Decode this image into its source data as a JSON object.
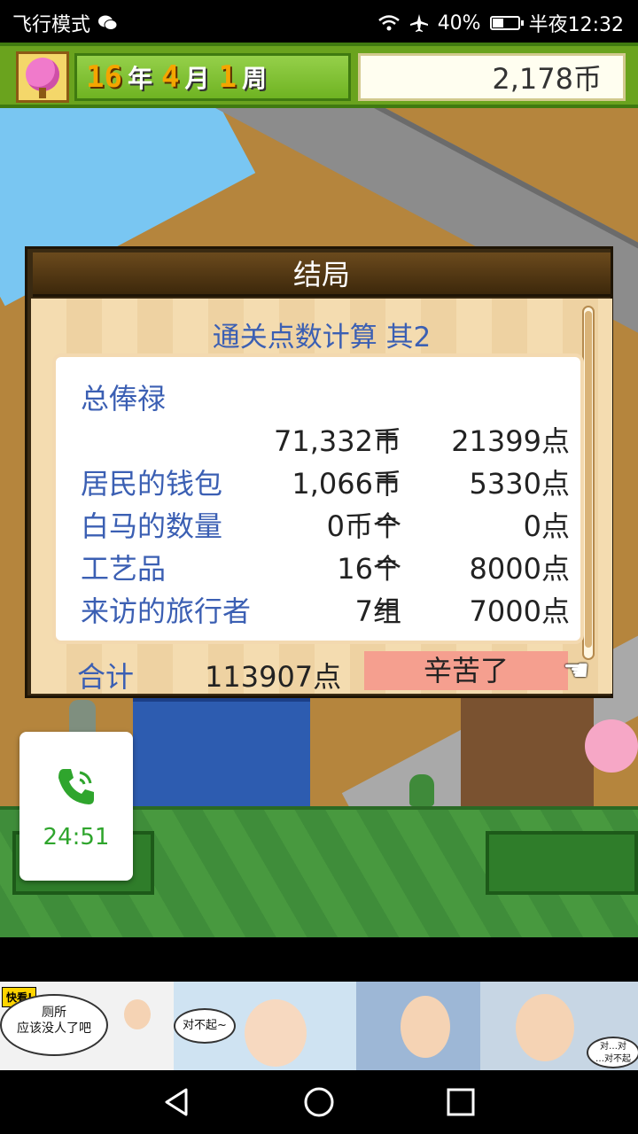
{
  "status_bar": {
    "airplane_mode_text": "飞行模式",
    "battery_percent": "40%",
    "battery_level": 0.4,
    "time": "半夜12:32"
  },
  "game_header": {
    "year_num": "16",
    "year_unit": "年",
    "month_num": "4",
    "month_unit": "月",
    "week_num": "1",
    "week_unit": "周",
    "coins": "2,178币"
  },
  "dialog": {
    "title": "结局",
    "subtitle": "通关点数计算 其2",
    "rows": [
      {
        "label": "总俸禄",
        "value": "",
        "eq": "",
        "points": ""
      },
      {
        "label": "",
        "value": "71,332币",
        "eq": "=",
        "points": "21399点"
      },
      {
        "label": "居民的钱包",
        "value": "1,066币",
        "eq": "=",
        "points": "5330点"
      },
      {
        "label": "白马的数量",
        "value": "0币个",
        "eq": "=",
        "points": "0点"
      },
      {
        "label": "工艺品",
        "value": "16个",
        "eq": "=",
        "points": "8000点"
      },
      {
        "label": "来访的旅行者",
        "value": "7组",
        "eq": "=",
        "points": "7000点"
      }
    ],
    "total_label": "合计",
    "total_value": "113907点",
    "thanks_button": "辛苦了"
  },
  "call_overlay": {
    "duration": "24:51",
    "icon": "phone-icon"
  },
  "ad": {
    "badge": "快看!",
    "bubble1_line1": "厕所",
    "bubble1_line2": "应该没人了吧",
    "bubble2": "对不起~",
    "bubble3_line1": "对…对",
    "bubble3_line2": "…对不起"
  },
  "colors": {
    "label_blue": "#3b5fb3",
    "header_green": "#6aa31e",
    "button_salmon": "#f59f8f",
    "call_green": "#2fa52d"
  }
}
